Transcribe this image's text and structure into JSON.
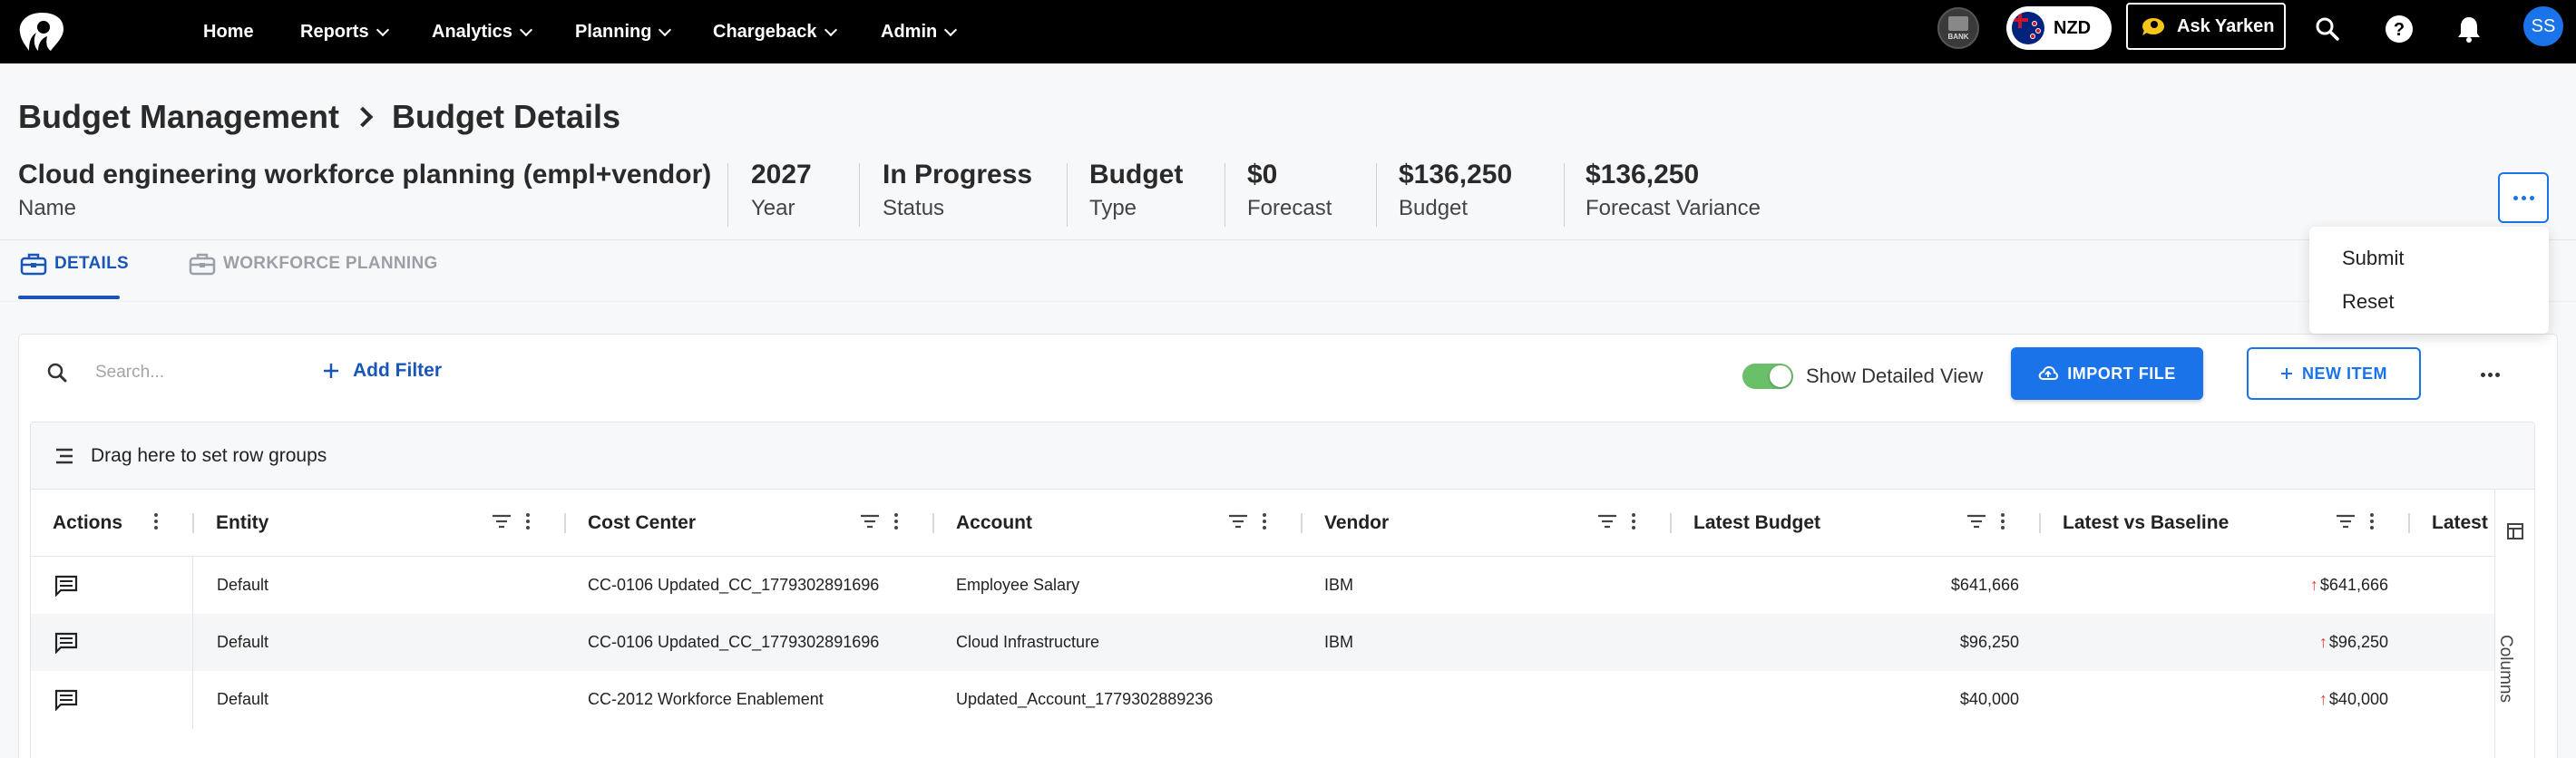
{
  "nav": {
    "items": [
      {
        "label": "Home",
        "dropdown": false
      },
      {
        "label": "Reports",
        "dropdown": true
      },
      {
        "label": "Analytics",
        "dropdown": true
      },
      {
        "label": "Planning",
        "dropdown": true
      },
      {
        "label": "Chargeback",
        "dropdown": true
      },
      {
        "label": "Admin",
        "dropdown": true
      }
    ],
    "bank_label": "BANK",
    "currency": "NZD",
    "ask_label": "Ask Yarken",
    "avatar_initials": "SS"
  },
  "breadcrumb": {
    "parent": "Budget Management",
    "current": "Budget Details"
  },
  "summary": {
    "name": {
      "value": "Cloud engineering workforce planning (empl+vendor)",
      "label": "Name"
    },
    "year": {
      "value": "2027",
      "label": "Year"
    },
    "status": {
      "value": "In Progress",
      "label": "Status"
    },
    "type": {
      "value": "Budget",
      "label": "Type"
    },
    "forecast": {
      "value": "$0",
      "label": "Forecast"
    },
    "budget": {
      "value": "$136,250",
      "label": "Budget"
    },
    "variance": {
      "value": "$136,250",
      "label": "Forecast Variance"
    }
  },
  "tabs": {
    "details": "DETAILS",
    "workforce": "WORKFORCE PLANNING"
  },
  "menu": {
    "submit": "Submit",
    "reset": "Reset"
  },
  "toolbar": {
    "search_placeholder": "Search...",
    "add_filter": "Add Filter",
    "toggle_label": "Show Detailed View",
    "toggle_on": true,
    "import_label": "IMPORT FILE",
    "new_label": "NEW ITEM"
  },
  "grid": {
    "group_hint": "Drag here to set row groups",
    "columns": {
      "actions": "Actions",
      "entity": "Entity",
      "cost_center": "Cost Center",
      "account": "Account",
      "vendor": "Vendor",
      "latest_budget": "Latest Budget",
      "latest_vs_baseline": "Latest vs Baseline",
      "latest_partial": "Latest"
    },
    "rows": [
      {
        "entity": "Default",
        "cost_center": "CC-0106 Updated_CC_1779302891696",
        "account": "Employee Salary",
        "vendor": "IBM",
        "latest_budget": "$641,666",
        "latest_vs_baseline": "$641,666"
      },
      {
        "entity": "Default",
        "cost_center": "CC-0106 Updated_CC_1779302891696",
        "account": "Cloud Infrastructure",
        "vendor": "IBM",
        "latest_budget": "$96,250",
        "latest_vs_baseline": "$96,250"
      },
      {
        "entity": "Default",
        "cost_center": "CC-2012 Workforce Enablement",
        "account": "Updated_Account_1779302889236",
        "vendor": "",
        "latest_budget": "$40,000",
        "latest_vs_baseline": "$40,000"
      }
    ],
    "columns_panel_label": "Columns"
  },
  "colors": {
    "accent": "#1a73e8",
    "nav_bg": "#000000",
    "toggle_on": "#6abf69",
    "increase_arrow": "#e53935"
  }
}
